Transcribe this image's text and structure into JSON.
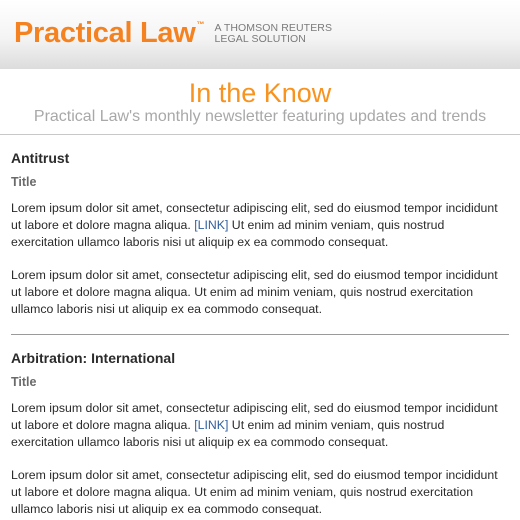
{
  "header": {
    "brand_name": "Practical Law",
    "trademark": "™",
    "tagline_line1": "A THOMSON REUTERS",
    "tagline_line2": "LEGAL SOLUTION"
  },
  "masthead": {
    "title": "In the Know",
    "subtitle": "Practical Law's monthly newsletter featuring updates and trends"
  },
  "colors": {
    "brand_orange": "#f58220",
    "link_blue": "#2f5f9e"
  },
  "sections": [
    {
      "heading": "Antitrust",
      "item_title": "Title",
      "para1_before": "Lorem ipsum dolor sit amet, consectetur adipiscing elit, sed do eiusmod tempor incididunt ut labore et dolore magna aliqua. ",
      "para1_link": "[LINK]",
      "para1_after": " Ut enim ad minim veniam, quis nostrud exercitation ullamco laboris nisi ut aliquip ex ea commodo consequat.",
      "para2": "Lorem ipsum dolor sit amet, consectetur adipiscing elit, sed do eiusmod tempor incididunt ut labore et dolore magna aliqua. Ut enim ad minim veniam, quis nostrud exercitation ullamco laboris nisi ut aliquip ex ea commodo consequat."
    },
    {
      "heading": "Arbitration: International",
      "item_title": "Title",
      "para1_before": "Lorem ipsum dolor sit amet, consectetur adipiscing elit, sed do eiusmod tempor incididunt ut labore et dolore magna aliqua. ",
      "para1_link": "[LINK]",
      "para1_after": " Ut enim ad minim veniam, quis nostrud exercitation ullamco laboris nisi ut aliquip ex ea commodo consequat.",
      "para2": "Lorem ipsum dolor sit amet, consectetur adipiscing elit, sed do eiusmod tempor incididunt ut labore et dolore magna aliqua. Ut enim ad minim veniam, quis nostrud exercitation ullamco laboris nisi ut aliquip ex ea commodo consequat."
    }
  ]
}
